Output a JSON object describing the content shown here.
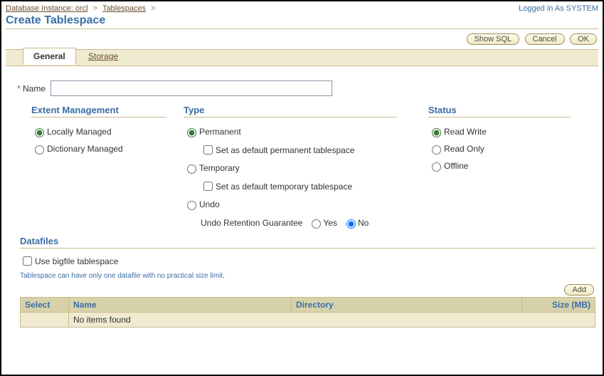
{
  "breadcrumb": {
    "instance_label": "Database Instance: orcl",
    "tablespaces_label": "Tablespaces",
    "sep": ">"
  },
  "logged_in": "Logged in As SYSTEM",
  "page_title": "Create Tablespace",
  "buttons": {
    "show_sql": "Show SQL",
    "cancel": "Cancel",
    "ok": "OK",
    "add": "Add"
  },
  "tabs": {
    "general": "General",
    "storage": "Storage"
  },
  "name_field": {
    "required_marker": "*",
    "label": "Name",
    "value": ""
  },
  "extent_mgmt": {
    "heading": "Extent Management",
    "locally": "Locally Managed",
    "dictionary": "Dictionary Managed"
  },
  "type": {
    "heading": "Type",
    "permanent": "Permanent",
    "set_default_perm": "Set as default permanent tablespace",
    "temporary": "Temporary",
    "set_default_temp": "Set as default temporary tablespace",
    "undo": "Undo",
    "undo_guarantee": "Undo Retention Guarantee",
    "yes": "Yes",
    "no": "No"
  },
  "status": {
    "heading": "Status",
    "read_write": "Read Write",
    "read_only": "Read Only",
    "offline": "Offline"
  },
  "datafiles": {
    "heading": "Datafiles",
    "bigfile": "Use bigfile tablespace",
    "hint": "Tablespace can have only one datafile with no practical size limit.",
    "columns": {
      "select": "Select",
      "name": "Name",
      "directory": "Directory",
      "size": "Size (MB)"
    },
    "empty": "No items found"
  }
}
